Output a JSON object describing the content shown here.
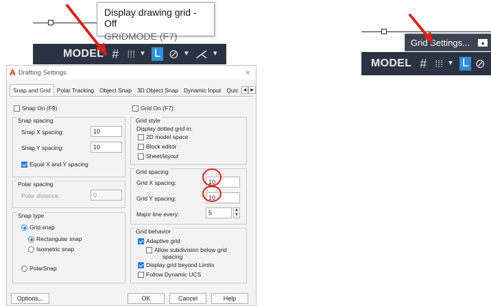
{
  "status_bar_left": {
    "model_label": "MODEL",
    "icons": [
      "grid-icon",
      "snap-icon",
      "dropdown-icon",
      "ortho-icon",
      "polar-icon",
      "dropdown-icon",
      "isodraft-icon",
      "dropdown-icon"
    ]
  },
  "tooltip": {
    "title": "Display drawing grid - Off",
    "subtitle": "GRIDMODE (F7)"
  },
  "status_bar_right": {
    "model_label": "MODEL",
    "context_menu_item": "Grid Settings..."
  },
  "dialog": {
    "title": "Drafting Settings",
    "close_glyph": "×",
    "tabs": [
      "Snap and Grid",
      "Polar Tracking",
      "Object Snap",
      "3D Object Snap",
      "Dynamic Input",
      "Quic"
    ],
    "snap_on_label": "Snap On (F9)",
    "grid_on_label": "Grid On (F7)",
    "snap_spacing": {
      "title": "Snap spacing",
      "x_label": "Snap X spacing:",
      "x_value": "10",
      "y_label": "Snap Y spacing:",
      "y_value": "10",
      "equal_label": "Equal X and Y spacing"
    },
    "polar_spacing": {
      "title": "Polar spacing",
      "distance_label": "Polar distance:",
      "distance_value": "0"
    },
    "snap_type": {
      "title": "Snap type",
      "grid_snap": "Grid snap",
      "rectangular": "Rectangular snap",
      "isometric": "Isometric snap",
      "polarsnap": "PolarSnap"
    },
    "grid_style": {
      "title": "Grid style",
      "subtitle": "Display dotted grid in:",
      "model_space": "2D model space",
      "block_editor": "Block editor",
      "sheet_layout": "Sheet/layout"
    },
    "grid_spacing": {
      "title": "Grid spacing",
      "x_label": "Grid X spacing:",
      "x_value": "10",
      "y_label": "Grid Y spacing:",
      "y_value": "10",
      "major_label": "Major line every:",
      "major_value": "5"
    },
    "grid_behavior": {
      "title": "Grid behavior",
      "adaptive": "Adaptive grid",
      "subdivision_line1": "Allow subdivision below grid",
      "subdivision_line2": "spacing",
      "beyond_limits": "Display grid beyond Limits",
      "follow_ucs": "Follow Dynamic UCS"
    },
    "buttons": {
      "options": "Options...",
      "ok": "OK",
      "cancel": "Cancel",
      "help": "Help"
    }
  },
  "colors": {
    "status_bar_bg": "#2b3241",
    "accent_blue": "#2f8fd8",
    "annotation_red": "#d62418"
  }
}
